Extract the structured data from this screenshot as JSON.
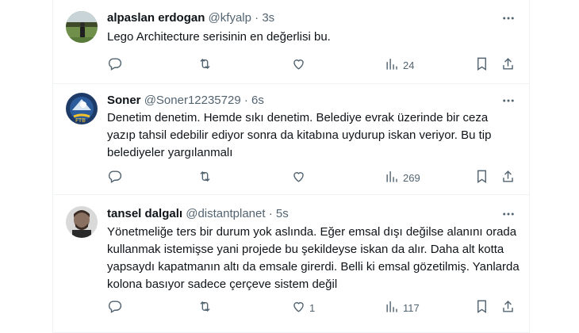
{
  "tweets": [
    {
      "name": "alpaslan erdogan",
      "handle": "@kfyalp",
      "sep": "·",
      "time": "3s",
      "text": "Lego Architecture serisinin en değerlisi bu.",
      "replies": "",
      "retweets": "",
      "likes": "",
      "views": "24"
    },
    {
      "name": "Soner",
      "handle": "@Soner12235729",
      "sep": "·",
      "time": "6s",
      "text": "Denetim denetim. Hemde sıkı denetim. Belediye evrak üzerinde bir ceza yazıp tahsil edebilir ediyor sonra da kitabına uydurup iskan veriyor. Bu tip belediyeler yargılanmalı",
      "replies": "",
      "retweets": "",
      "likes": "",
      "views": "269"
    },
    {
      "name": "tansel dalgalı",
      "handle": "@distantplanet",
      "sep": "·",
      "time": "5s",
      "text": "Yönetmeliğe ters bir durum yok aslında. Eğer emsal dışı değilse alanını orada kullanmak istemişse yani projede bu şekildeyse iskan da alır. Daha alt kotta yapsaydı kapatmanın altı da emsale girerdi. Belli ki emsal gözetilmiş. Yanlarda kolona basıyor sadece çerçeve sistem değil",
      "replies": "",
      "retweets": "",
      "likes": "1",
      "views": "117"
    }
  ],
  "colors": {
    "text": "#0f1419",
    "secondary": "#536471",
    "border": "#eff3f4"
  },
  "icons": [
    "more-icon",
    "reply-icon",
    "retweet-icon",
    "like-icon",
    "views-icon",
    "bookmark-icon",
    "share-icon"
  ]
}
